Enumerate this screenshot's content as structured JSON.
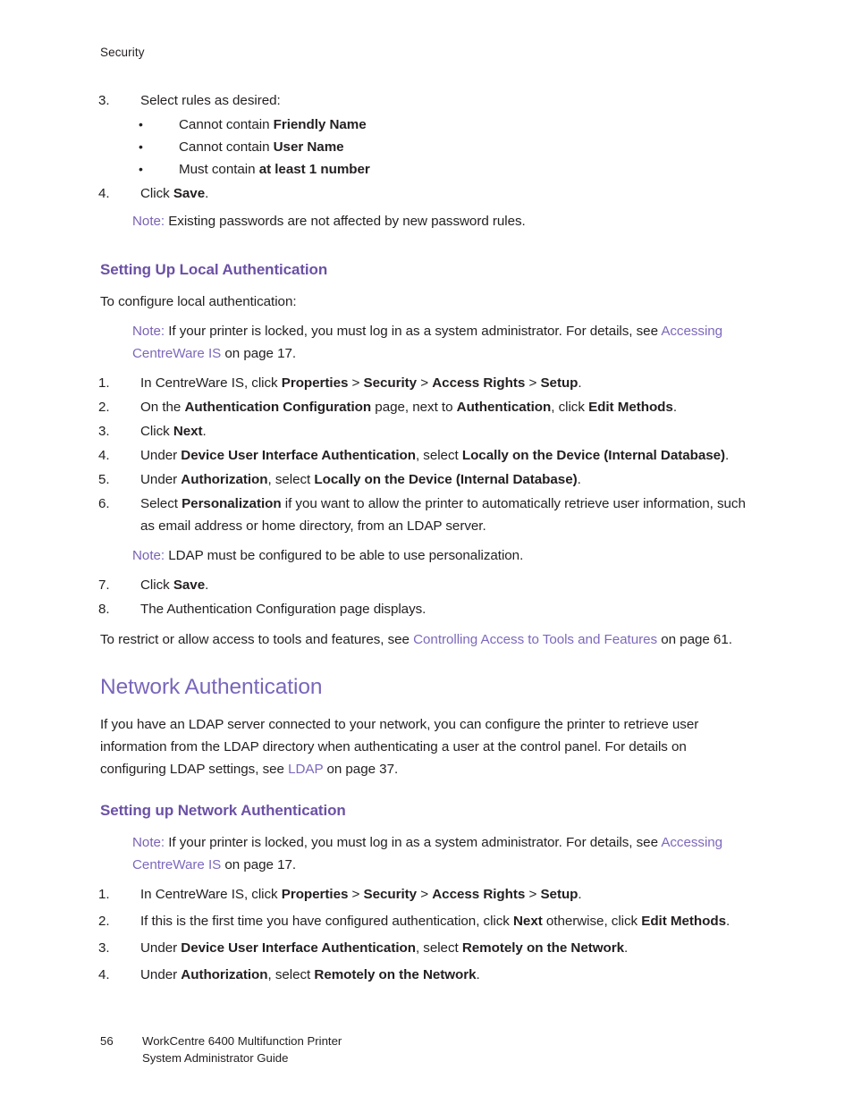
{
  "document": {
    "running_head": "Security",
    "footer": {
      "page_number": "56",
      "line1": "WorkCentre 6400 Multifunction Printer",
      "line2": "System Administrator Guide"
    },
    "colors": {
      "heading_main": "#7a66bb",
      "heading_sub": "#6b51a5",
      "link": "#7e68bd",
      "note_label": "#7a62b5",
      "body_text": "#231f20",
      "page_background": "#ffffff"
    }
  },
  "continued_list": {
    "item3": {
      "marker": "3.",
      "text": "Select rules as desired:"
    },
    "bullets": [
      {
        "marker": "•",
        "text_plain": "Cannot contain ",
        "text_bold": "Friendly Name"
      },
      {
        "marker": "•",
        "text_plain": "Cannot contain ",
        "text_bold": "User Name"
      },
      {
        "marker": "•",
        "text_plain": "Must contain ",
        "text_bold": "at least 1 number"
      }
    ],
    "item4": {
      "marker": "4.",
      "prefix": "Click ",
      "bold": "Save",
      "suffix": "."
    },
    "note": {
      "label": "Note:",
      "text": " Existing passwords are not affected by new password rules."
    }
  },
  "section_local": {
    "heading": "Setting Up Local Authentication",
    "intro": "To configure local authentication:",
    "note": {
      "label": "Note:",
      "text_a": " If your printer is locked, you must log in as a system administrator. For details, see ",
      "link": "Accessing CentreWare IS",
      "text_b": " on page 17."
    },
    "steps": {
      "s1": {
        "marker": "1.",
        "a": "In CentreWare IS, click ",
        "b1": "Properties",
        "sep1": " > ",
        "b2": "Security",
        "sep2": " > ",
        "b3": "Access Rights",
        "sep3": " > ",
        "b4": "Setup",
        "end": "."
      },
      "s2": {
        "marker": "2.",
        "a": "On the ",
        "b1": "Authentication Configuration",
        "c": " page, next to ",
        "b2": "Authentication",
        "d": ", click ",
        "b3": "Edit Methods",
        "end": "."
      },
      "s3": {
        "marker": "3.",
        "a": "Click ",
        "b1": "Next",
        "end": "."
      },
      "s4": {
        "marker": "4.",
        "a": "Under ",
        "b1": "Device User Interface Authentication",
        "c": ", select ",
        "b2": "Locally on the Device (Internal Database)",
        "end": "."
      },
      "s5": {
        "marker": "5.",
        "a": "Under ",
        "b1": "Authorization",
        "c": ", select ",
        "b2": "Locally on the Device (Internal Database)",
        "end": "."
      },
      "s6": {
        "marker": "6.",
        "a": "Select ",
        "b1": "Personalization",
        "c": " if you want to allow the printer to automatically retrieve user information, such as email address or home directory, from an LDAP server."
      },
      "s6_note": {
        "label": "Note:",
        "text": " LDAP must be configured to be able to use personalization."
      },
      "s7": {
        "marker": "7.",
        "a": "Click ",
        "b1": "Save",
        "end": "."
      },
      "s8": {
        "marker": "8.",
        "a": "The Authentication Configuration page displays."
      }
    },
    "closing": {
      "a": "To restrict or allow access to tools and features, see ",
      "link": "Controlling Access to Tools and Features",
      "b": " on page 61."
    }
  },
  "section_network": {
    "heading": "Network Authentication",
    "intro": {
      "a": "If you have an LDAP server connected to your network, you can configure the printer to retrieve user information from the LDAP directory when authenticating a user at the control panel. For details on configuring LDAP settings, see ",
      "link": "LDAP",
      "b": " on page 37."
    },
    "sub_heading": "Setting up Network Authentication",
    "note": {
      "label": "Note:",
      "text_a": " If your printer is locked, you must log in as a system administrator. For details, see ",
      "link": "Accessing CentreWare IS",
      "text_b": " on page 17."
    },
    "steps": {
      "s1": {
        "marker": "1.",
        "a": "In CentreWare IS, click ",
        "b1": "Properties",
        "sep1": " > ",
        "b2": "Security",
        "sep2": " > ",
        "b3": "Access Rights",
        "sep3": " > ",
        "b4": "Setup",
        "end": "."
      },
      "s2": {
        "marker": "2.",
        "a": "If this is the first time you have configured authentication, click ",
        "b1": "Next",
        "c": " otherwise, click ",
        "b2": "Edit Methods",
        "end": "."
      },
      "s3": {
        "marker": "3.",
        "a": "Under ",
        "b1": "Device User Interface Authentication",
        "c": ", select ",
        "b2": "Remotely on the Network",
        "end": "."
      },
      "s4": {
        "marker": "4.",
        "a": "Under ",
        "b1": "Authorization",
        "c": ", select ",
        "b2": "Remotely on the Network",
        "end": "."
      }
    }
  }
}
